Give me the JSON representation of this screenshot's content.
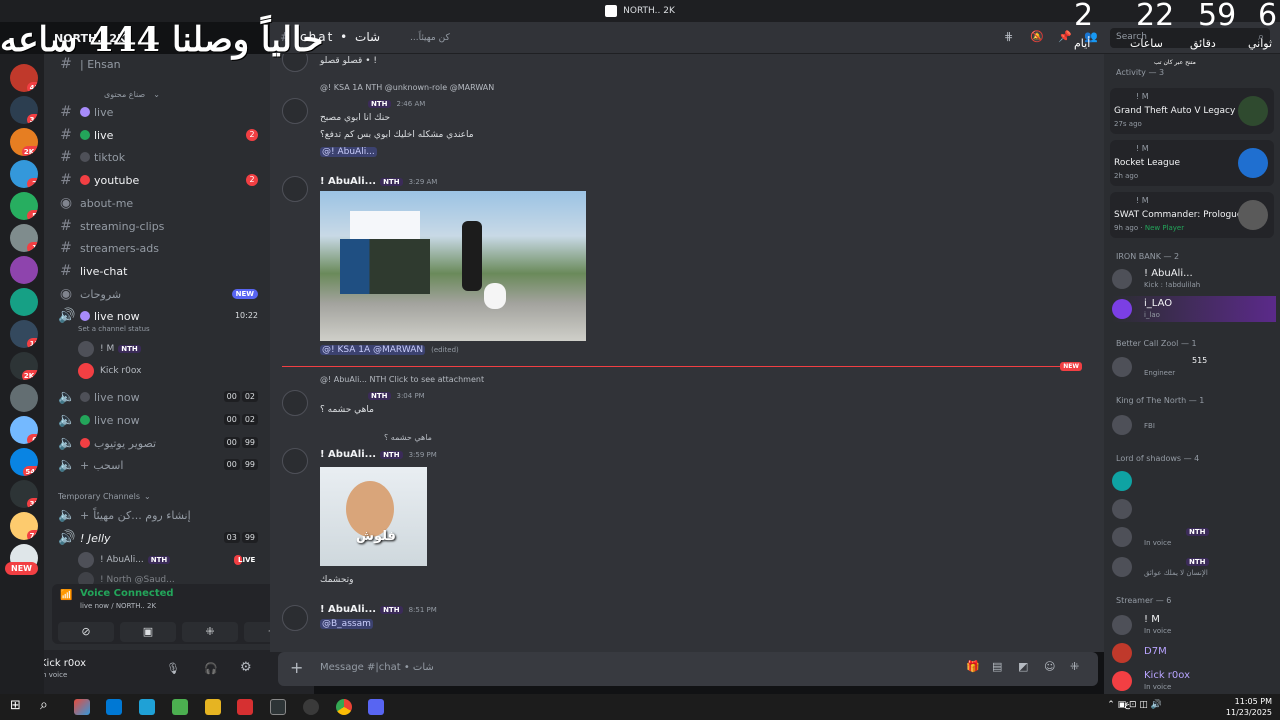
{
  "titlebar": {
    "title": "NORTH.. 2K"
  },
  "overlay": {
    "text": "حالياً وصلنا 444 ساعه"
  },
  "countdown": {
    "d": "6",
    "h": "59",
    "m": "22",
    "s": "2",
    "d_lbl": "ثواني",
    "h_lbl": "دقائق",
    "m_lbl": "ساعات",
    "s_lbl": "أيام"
  },
  "rail": {
    "badges": [
      "45",
      "34",
      "2K+",
      "2",
      "5",
      "1",
      "15",
      "2K+",
      "6",
      "542",
      "37",
      "70"
    ],
    "new_label": "NEW"
  },
  "server": {
    "name": "NORTH.. 2K"
  },
  "channels": {
    "top": "| Ehsan",
    "category": "صناع محتوى",
    "live1": "live",
    "live2": "live",
    "live2_badge": "2",
    "tiktok": "tiktok",
    "youtube": "youtube",
    "youtube_badge": "2",
    "about": "about-me",
    "clips": "streaming-clips",
    "ads": "streamers-ads",
    "livechat": "live-chat",
    "sharh": "شروحات",
    "new_pill": "NEW",
    "livenow": "live now",
    "livenow_time": "10:22",
    "status": "Set a channel status",
    "vu1": "! M",
    "vu2": "Kick r0ox",
    "v1": "live now",
    "v1_c": [
      "00",
      "02"
    ],
    "v2": "live now",
    "v2_c": [
      "00",
      "02"
    ],
    "v3": "تصوير يوتيوب",
    "v3_c": [
      "00",
      "99"
    ],
    "v4": "اسحب",
    "v4_c": [
      "00",
      "99"
    ],
    "temp": "Temporary Channels",
    "create": "إنشاء روم ...كن مهيئاً",
    "jelly": "! Jelly",
    "jelly_c": [
      "03",
      "99"
    ],
    "abuali": "! AbuAli...",
    "live_pill": "LIVE",
    "north": "! North @Saud..."
  },
  "voice": {
    "title": "Voice Connected",
    "sub": "live now / NORTH.. 2K"
  },
  "user": {
    "name": "Kick r0ox",
    "status": "In voice"
  },
  "header": {
    "channel": "|chat • شات",
    "topic": "...كن مهيئاً"
  },
  "search": {
    "placeholder": "Search"
  },
  "messages": {
    "m0": "قصلو قصلو • !",
    "r1": "@! KSA 1A NTH @unknown-role @MARWAN",
    "m1_ts": "2:46 AM",
    "m1_a": "حنك انا ابوي مصبح",
    "m1_b": "ماعندي مشكله اخليك ابوي بس كم تدفع؟",
    "m1_mention": "@! AbuAli...",
    "m2_user": "! AbuAli...",
    "m2_ts": "3:29 AM",
    "m2_mentions": "@! KSA 1A  @MARWAN",
    "edited": "(edited)",
    "new_label": "NEW",
    "r3": "@! AbuAli... NTH Click to see attachment",
    "m3_ts": "3:04 PM",
    "m3_text": "ماهي حشمه ؟",
    "r4": "ماهي حشمه ؟",
    "m4_user": "! AbuAli...",
    "m4_ts": "3:59 PM",
    "gif_text": "فلوش",
    "m4_text": "وتحشمك",
    "m5_user": "! AbuAli...",
    "m5_ts": "8:51 PM",
    "m5_mention": "@B_assam",
    "nth": "NTH"
  },
  "composer": {
    "placeholder": "Message #|chat • شات"
  },
  "members": {
    "top": "متنح عبر كان تب",
    "activity": "Activity — 3",
    "a1_user": "! M",
    "a1_game": "Grand Theft Auto V Legacy",
    "a1_time": "27s ago",
    "a2_user": "! M",
    "a2_game": "Rocket League",
    "a2_time": "2h ago",
    "a3_user": "! M",
    "a3_game": "SWAT Commander: Prologue",
    "a3_time": "9h ago",
    "a3_extra": "New Player",
    "iron": "IRON BANK — 2",
    "ib1": "! AbuAli...",
    "ib1_s": "Kick : !abdulilah",
    "ib2": "i_LAO",
    "ib2_s": "i_lao",
    "bcz": "Better Call Zool — 1",
    "bcz_s": "Engineer",
    "bcz_n": "515",
    "kotn": "King of The North — 1",
    "kotn_s": "FBI",
    "los": "Lord of shadows — 4",
    "los_s3": "In voice",
    "los_s4": "الإنسان لا يملك عوائق",
    "streamer": "Streamer — 6",
    "st1": "! M",
    "st1_s": "In voice",
    "st2": "D7M",
    "st3": "Kick r0ox",
    "st3_s": "In voice"
  },
  "taskbar": {
    "time": "11:05 PM",
    "date": "11/23/2025",
    "lang": "ع"
  }
}
